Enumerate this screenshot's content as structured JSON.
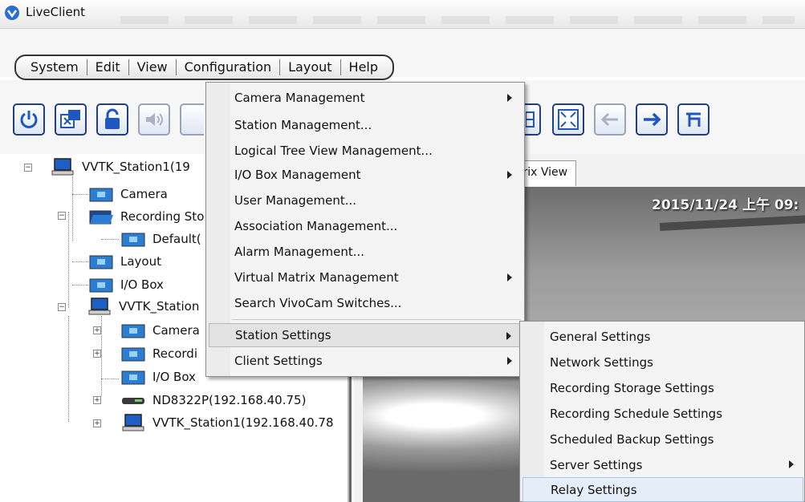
{
  "window": {
    "title": "LiveClient"
  },
  "menubar": {
    "items": [
      "System",
      "Edit",
      "View",
      "Configuration",
      "Layout",
      "Help"
    ]
  },
  "toolbar": {
    "buttons": [
      "power-icon",
      "switch-monitor-icon",
      "lock-icon",
      "speaker-icon",
      "layout-icon",
      "fullscreen-icon",
      "back-arrow-icon",
      "forward-arrow-icon",
      "return-icon"
    ]
  },
  "tree": {
    "root_label": "VVTK_Station1(19",
    "children": {
      "camera": "Camera",
      "recording_storage": "Recording Sto",
      "default": "Default(",
      "layout": "Layout",
      "io_box": "I/O Box",
      "station2": "VVTK_Station",
      "station2_camera": "Camera",
      "station2_recording": "Recordi",
      "station2_io": "I/O Box",
      "nd8322p": "ND8322P(192.168.40.75)",
      "station1b": "VVTK_Station1(192.168.40.78"
    }
  },
  "view": {
    "tab_label": "trix View",
    "timestamp": "2015/11/24 上午 09:"
  },
  "configuration_menu": {
    "items": [
      {
        "label": "Camera Management",
        "submenu": true
      },
      {
        "label": "Station Management...",
        "submenu": false
      },
      {
        "label": "Logical Tree View Management...",
        "submenu": false
      },
      {
        "label": "I/O Box Management",
        "submenu": true
      },
      {
        "label": "User Management...",
        "submenu": false
      },
      {
        "label": "Association Management...",
        "submenu": false
      },
      {
        "label": "Alarm Management...",
        "submenu": false
      },
      {
        "label": "Virtual Matrix Management",
        "submenu": true
      },
      {
        "label": "Search VivoCam Switches...",
        "submenu": false
      },
      {
        "label": "Station Settings",
        "submenu": true
      },
      {
        "label": "Client Settings",
        "submenu": true
      }
    ]
  },
  "station_settings_menu": {
    "items": [
      {
        "label": "General Settings",
        "submenu": false
      },
      {
        "label": "Network Settings",
        "submenu": false
      },
      {
        "label": "Recording Storage Settings",
        "submenu": false
      },
      {
        "label": "Recording Schedule Settings",
        "submenu": false
      },
      {
        "label": "Scheduled Backup Settings",
        "submenu": false
      },
      {
        "label": "Server Settings",
        "submenu": true
      },
      {
        "label": "Relay Settings",
        "submenu": false
      }
    ]
  },
  "colors": {
    "toolbar_border": "#1f3f86",
    "hover_item": "#e5edf8",
    "highlight_item": "#e3e3e3"
  }
}
